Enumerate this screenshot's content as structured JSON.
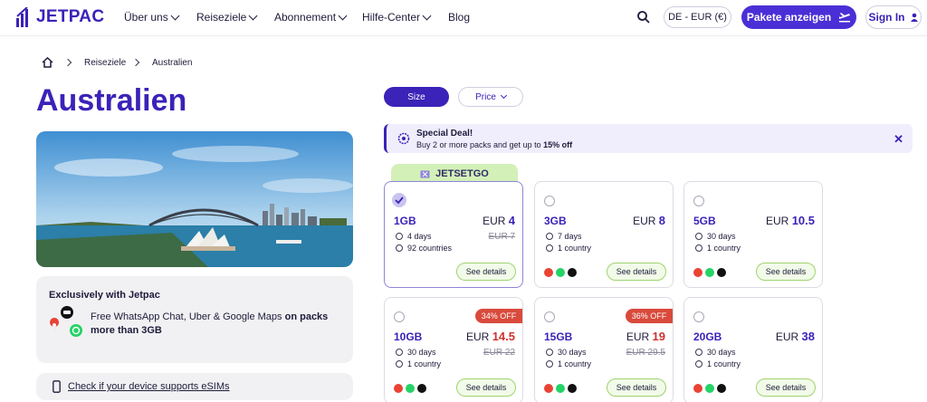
{
  "brand": {
    "name": "JETPAC"
  },
  "nav": {
    "items": [
      {
        "label": "Über uns"
      },
      {
        "label": "Reiseziele"
      },
      {
        "label": "Abonnement"
      },
      {
        "label": "Hilfe-Center"
      },
      {
        "label": "Blog"
      }
    ],
    "lang": "DE - EUR (€)",
    "cta": "Pakete anzeigen",
    "signin": "Sign In"
  },
  "breadcrumb": [
    "Reiseziele",
    "Australien"
  ],
  "page": {
    "title": "Australien"
  },
  "exclusive": {
    "title": "Exclusively with Jetpac",
    "text": "Free WhatsApp Chat, Uber & Google Maps",
    "bold": "on packs more than 3GB"
  },
  "device_link": "Check if your device supports eSIMs",
  "filters": {
    "size": "Size",
    "price": "Price"
  },
  "deal": {
    "title": "Special Deal!",
    "text": "Buy 2 or more packs and get up to ",
    "bold": "15% off"
  },
  "promo_code": "JETSETGO",
  "plans": [
    {
      "data": "1GB",
      "currency": "EUR",
      "price": "4",
      "old": "EUR 7",
      "days": "4 days",
      "coverage": "92 countries",
      "details": "See details"
    },
    {
      "data": "3GB",
      "currency": "EUR",
      "price": "8",
      "old": "",
      "days": "7 days",
      "coverage": "1 country",
      "details": "See details"
    },
    {
      "data": "5GB",
      "currency": "EUR",
      "price": "10.5",
      "old": "",
      "days": "30 days",
      "coverage": "1 country",
      "details": "See details"
    },
    {
      "data": "10GB",
      "currency": "EUR",
      "price": "14.5",
      "old": "EUR 22",
      "days": "30 days",
      "coverage": "1 country",
      "details": "See details",
      "badge": "34% OFF"
    },
    {
      "data": "15GB",
      "currency": "EUR",
      "price": "19",
      "old": "EUR 29.5",
      "days": "30 days",
      "coverage": "1 country",
      "details": "See details",
      "badge": "36% OFF"
    },
    {
      "data": "20GB",
      "currency": "EUR",
      "price": "38",
      "old": "",
      "days": "30 days",
      "coverage": "1 country",
      "details": "See details"
    }
  ],
  "colors": {
    "brand": "#3b22b8",
    "accent": "#4b2fd6",
    "discount": "#d94a3c",
    "promo": "#d3f0b8"
  }
}
